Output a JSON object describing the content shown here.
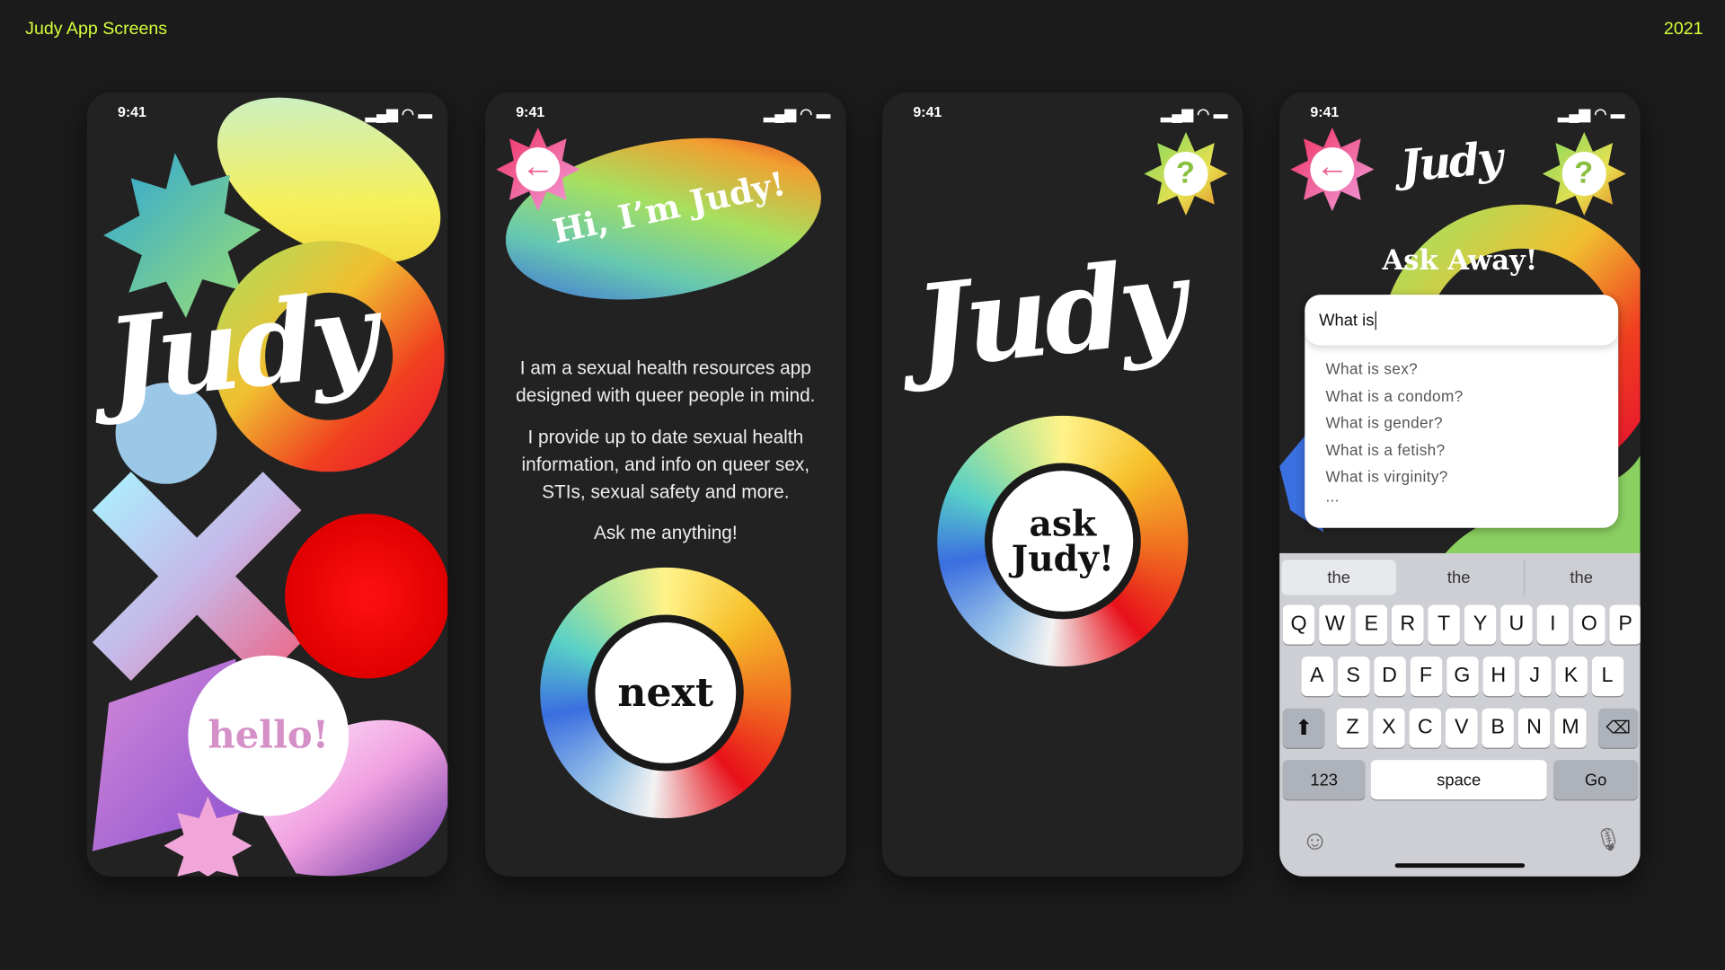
{
  "header": {
    "title": "Judy App Screens",
    "year": "2021",
    "accent": "#d6ff3a"
  },
  "status": {
    "time": "9:41"
  },
  "screen1": {
    "logo": "Judy",
    "bubble": "hello!"
  },
  "screen2": {
    "greeting": "Hi, I’m Judy!",
    "paragraphs": [
      "I am a sexual health resources app designed with queer people in mind.",
      "I provide up to date sexual health information, and info on queer sex, STIs, sexual safety and more.",
      "Ask me anything!"
    ],
    "next_label": "next",
    "back_icon": "arrow-left-icon"
  },
  "screen3": {
    "logo": "Judy",
    "ask_label": "ask Judy!",
    "help_icon": "question-icon"
  },
  "screen4": {
    "logo": "Judy",
    "heading": "Ask Away!",
    "search_value": "What is",
    "suggestions": [
      "What is sex?",
      "What is a condom?",
      "What is gender?",
      "What is a fetish?",
      "What is virginity?",
      "..."
    ],
    "keyboard": {
      "predictions": [
        "the",
        "the",
        "the"
      ],
      "rows": [
        [
          "Q",
          "W",
          "E",
          "R",
          "T",
          "Y",
          "U",
          "I",
          "O",
          "P"
        ],
        [
          "A",
          "S",
          "D",
          "F",
          "G",
          "H",
          "J",
          "K",
          "L"
        ],
        [
          "Z",
          "X",
          "C",
          "V",
          "B",
          "N",
          "M"
        ]
      ],
      "numbers": "123",
      "space": "space",
      "go": "Go"
    }
  }
}
